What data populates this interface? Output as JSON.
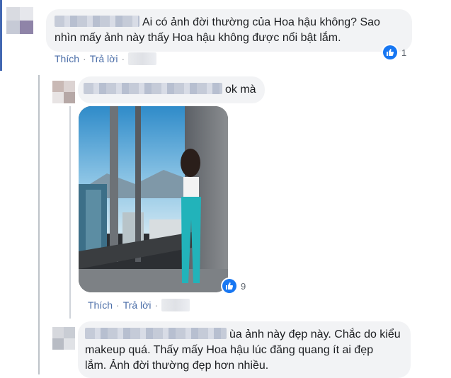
{
  "comments": [
    {
      "text": "Ai có ảnh đời thường của Hoa hậu không? Sao nhìn mấy ảnh này thấy Hoa hậu không được nổi bật lắm.",
      "reaction_count": "1",
      "actions": {
        "like": "Thích",
        "reply": "Trả lời"
      }
    }
  ],
  "replies": [
    {
      "text": "ok mà",
      "reaction_count": "9",
      "actions": {
        "like": "Thích",
        "reply": "Trả lời"
      },
      "has_photo": true
    },
    {
      "text_line1": "ùa ảnh này đẹp này. Chắc do kiểu",
      "text_line2": "makeup quá. Thấy mấy Hoa hậu lúc đăng quang ít ai đẹp",
      "text_line3": "lắm. Ảnh đời thường đẹp hơn nhiều."
    }
  ],
  "colors": {
    "link": "#4b6ea8",
    "like": "#1877f2",
    "bubble": "#f2f3f5"
  }
}
